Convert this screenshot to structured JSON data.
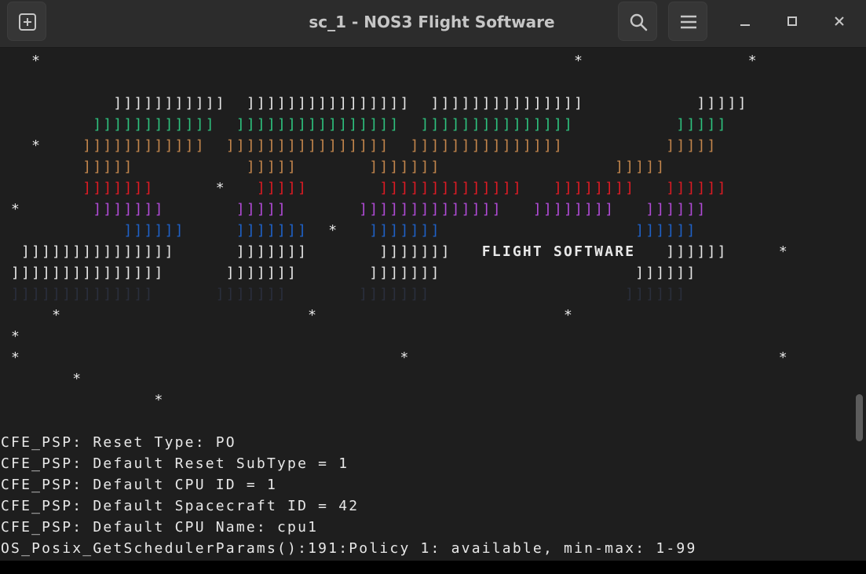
{
  "window": {
    "title": "sc_1 - NOS3 Flight Software",
    "new_tab_icon": "new-tab-icon",
    "search_icon": "search-icon",
    "menu_icon": "hamburger-menu-icon",
    "minimize_icon": "minimize-icon",
    "maximize_icon": "maximize-icon",
    "close_icon": "close-icon"
  },
  "colors": {
    "background": "#1e1e1e",
    "titlebar": "#2c2c2c",
    "white": "#e8e8e8",
    "green": "#2ec27e",
    "orange": "#c4864c",
    "red": "#e01b24",
    "purple": "#b24bd8",
    "blue": "#1f62c9",
    "dark": "#2a2f3d"
  },
  "banner": {
    "l00": "   *                                                    *                *",
    "l01": "",
    "l02a": "           ]]]]]]]]]]]  ]]]]]]]]]]]]]]]]  ]]]]]]]]]]]]]]]           ]]]]]",
    "l03a": "         ]]]]]]]]]]]]  ]]]]]]]]]]]]]]]]  ]]]]]]]]]]]]]]]          ]]]]]",
    "l04a": "   *    ",
    "l04b": "]]]]]]]]]]]]  ]]]]]]]]]]]]]]]]  ]]]]]]]]]]]]]]]          ]]]]]",
    "l05a": "        ]]]]]           ]]]]]       ]]]]]]]                 ]]]]]",
    "l06a": "        ]]]]]]]      ",
    "l06b": "*   ",
    "l06c": "]]]]]       ]]]]]]]]]]]]]]   ]]]]]]]]   ]]]]]]",
    "l07a": " *       ",
    "l07b": "]]]]]]]       ]]]]]       ]]]]]]]]]]]]]]   ]]]]]]]]   ]]]]]]",
    "l08a": "            ]]]]]]     ]]]]]]]  ",
    "l08b": "*   ",
    "l08c": "]]]]]]]                   ]]]]]]",
    "l09a": "  ]]]]]]]]]]]]]]]      ]]]]]]]       ]]]]]]]   ",
    "l09b": "FLIGHT SOFTWARE",
    "l09c": "   ]]]]]]     *",
    "l10a": " ]]]]]]]]]]]]]]]      ]]]]]]]       ]]]]]]]                   ]]]]]]",
    "l11a": " ]]]]]]]]]]]]]]      ]]]]]]]       ]]]]]]]                   ]]]]]]",
    "l12": "     *                        *                        *",
    "l13": " *",
    "l14": " *                                     *                                    *",
    "l15": "       *",
    "l16": "               *"
  },
  "log": [
    "CFE_PSP: Reset Type: PO",
    "CFE_PSP: Default Reset SubType = 1",
    "CFE_PSP: Default CPU ID = 1",
    "CFE_PSP: Default Spacecraft ID = 42",
    "CFE_PSP: Default CPU Name: cpu1",
    "OS_Posix_GetSchedulerParams():191:Policy 1: available, min-max: 1-99"
  ]
}
